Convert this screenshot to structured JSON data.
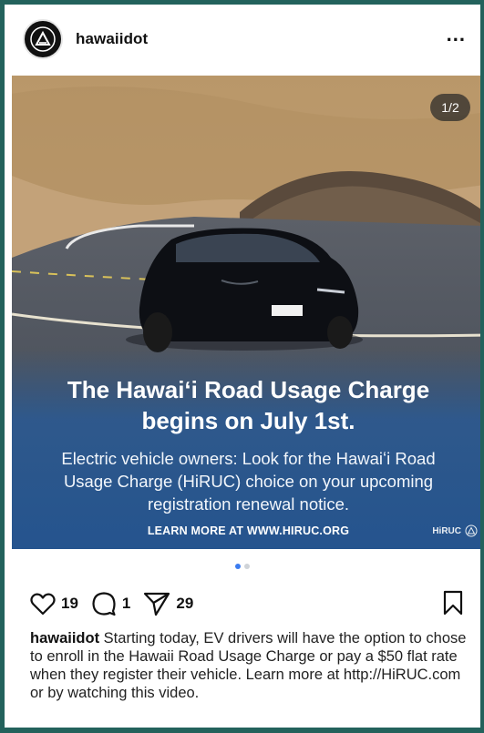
{
  "post": {
    "username": "hawaiidot",
    "more_label": "...",
    "slide_counter": "1/2",
    "slide_index": 1,
    "slide_total": 2
  },
  "media": {
    "headline_line1": "The Hawaiʻi Road Usage Charge",
    "headline_line2": "begins on July 1st.",
    "subtext_line1": "Electric vehicle owners: Look for the Hawaiʻi Road",
    "subtext_line2": "Usage Charge (HiRUC) choice on your upcoming",
    "subtext_line3": "registration renewal notice.",
    "learn_more": "LEARN MORE AT WWW.HIRUC.ORG",
    "corner_logo_text": "HiRUC"
  },
  "actions": {
    "likes": "19",
    "comments": "1",
    "shares": "29"
  },
  "caption": {
    "username": "hawaiidot",
    "text": " Starting today, EV drivers will have the option to chose to enroll in the Hawaii Road Usage Charge or pay a $50 flat rate when they register their vehicle. Learn more at http://HiRUC.com or by watching this video."
  },
  "colors": {
    "border": "#23625c",
    "overlay_blue": "#2a5a94",
    "dot_active": "#3b7cf0",
    "dot_inactive": "#cfd3d8"
  },
  "icons": [
    "hawaii-dot-logo-icon",
    "more-icon",
    "heart-icon",
    "comment-icon",
    "share-icon",
    "bookmark-icon"
  ]
}
